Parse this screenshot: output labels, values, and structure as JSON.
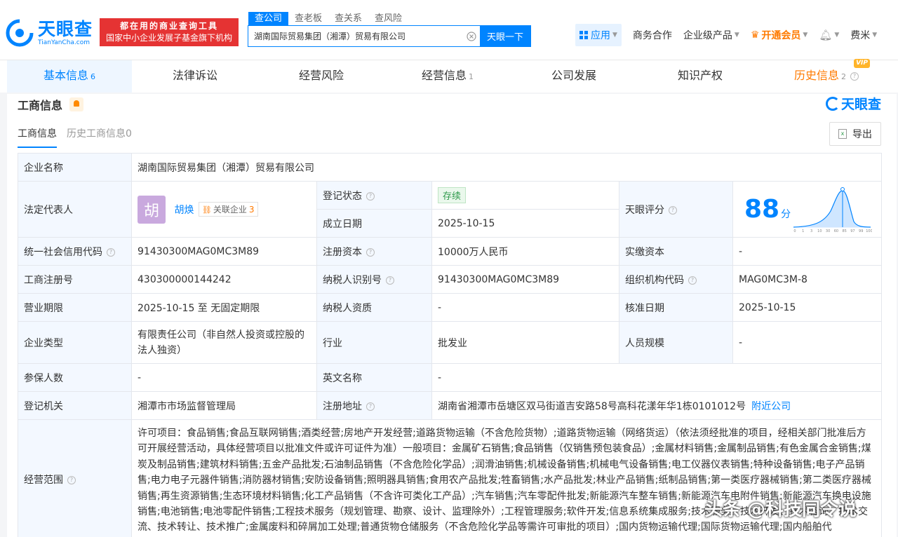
{
  "brand": {
    "name_cn": "天眼查",
    "name_en": "TianYanCha.com",
    "promo_line1": "都在用的商业查询工具",
    "promo_line2": "国家中小企业发展子基金旗下机构"
  },
  "search": {
    "tabs": [
      "查公司",
      "查老板",
      "查关系",
      "查风险"
    ],
    "value": "湖南国际贸易集团（湘潭）贸易有限公司",
    "button": "天眼一下"
  },
  "nav": {
    "app": "应用",
    "business": "商务合作",
    "enterprise": "企业级产品",
    "vip": "开通会员",
    "user": "费米"
  },
  "tabs": [
    {
      "label": "基本信息",
      "count": "6"
    },
    {
      "label": "法律诉讼",
      "count": ""
    },
    {
      "label": "经营风险",
      "count": ""
    },
    {
      "label": "经营信息",
      "count": "1"
    },
    {
      "label": "公司发展",
      "count": ""
    },
    {
      "label": "知识产权",
      "count": ""
    },
    {
      "label": "历史信息",
      "count": "2",
      "badge": "VIP"
    }
  ],
  "section": {
    "title": "工商信息",
    "brand_right": "天眼查",
    "subtab_active": "工商信息",
    "subtab_history": "历史工商信息0",
    "export": "导出"
  },
  "info": {
    "company_name_label": "企业名称",
    "company_name": "湖南国际贸易集团（湘潭）贸易有限公司",
    "legal_rep_label": "法定代表人",
    "legal_rep_avatar": "胡",
    "legal_rep_name": "胡焕",
    "related_label": "关联企业",
    "related_count": "3",
    "reg_status_label": "登记状态",
    "reg_status": "存续",
    "found_date_label": "成立日期",
    "found_date": "2025-10-15",
    "score_label": "天眼评分",
    "score": "88",
    "score_unit": "分",
    "credit_code_label": "统一社会信用代码",
    "credit_code": "91430300MAG0MC3M89",
    "reg_capital_label": "注册资本",
    "reg_capital": "10000万人民币",
    "paid_capital_label": "实缴资本",
    "paid_capital": "-",
    "reg_no_label": "工商注册号",
    "reg_no": "430300000144242",
    "taxpayer_id_label": "纳税人识别号",
    "taxpayer_id": "91430300MAG0MC3M89",
    "org_code_label": "组织机构代码",
    "org_code": "MAG0MC3M-8",
    "term_label": "营业期限",
    "term": "2025-10-15 至 无固定期限",
    "taxpayer_qual_label": "纳税人资质",
    "taxpayer_qual": "-",
    "approve_date_label": "核准日期",
    "approve_date": "2025-10-15",
    "type_label": "企业类型",
    "type": "有限责任公司（非自然人投资或控股的法人独资）",
    "industry_label": "行业",
    "industry": "批发业",
    "staff_label": "人员规模",
    "staff": "-",
    "insured_label": "参保人数",
    "insured": "-",
    "en_name_label": "英文名称",
    "en_name": "-",
    "authority_label": "登记机关",
    "authority": "湘潭市市场监督管理局",
    "address_label": "注册地址",
    "address": "湖南省湘潭市岳塘区双马街道吉安路58号高科花漾年华1栋0101012号",
    "nearby_link": "附近公司",
    "scope_label": "经营范围",
    "scope": "许可项目：食品销售;食品互联网销售;酒类经营;房地产开发经营;道路货物运输（不含危险货物）;道路货物运输（网络货运）（依法须经批准的项目，经相关部门批准后方可开展经营活动，具体经营项目以批准文件或许可证件为准）一般项目：金属矿石销售;食品销售（仅销售预包装食品）;金属材料销售;金属制品销售;有色金属合金销售;煤炭及制品销售;建筑材料销售;五金产品批发;石油制品销售（不含危险化学品）;润滑油销售;机械设备销售;机械电气设备销售;电工仪器仪表销售;特种设备销售;电子产品销售;电力电子元器件销售;消防器材销售;安防设备销售;照明器具销售;食用农产品批发;牲畜销售;水产品批发;林业产品销售;纸制品销售;第一类医疗器械销售;第二类医疗器械销售;再生资源销售;生态环境材料销售;化工产品销售（不含许可类化工产品）;汽车销售;汽车零配件批发;新能源汽车整车销售;新能源汽车电附件销售;新能源汽车换电设施销售;电池销售;电池零配件销售;工程技术服务（规划管理、勘察、设计、监理除外）;工程管理服务;软件开发;信息系统集成服务;技术服务、技术开发、技术咨询、技术交流、技术转让、技术推广;金属废料和碎屑加工处理;普通货物仓储服务（不含危险化学品等需许可审批的项目）;国内货物运输代理;国际货物运输代理;国内船舶代"
  },
  "score_chart": {
    "x_ticks": [
      "0",
      "1",
      "3",
      "10",
      "30",
      "60",
      "85",
      "97",
      "99",
      "100"
    ]
  },
  "watermark": "头条 @科技同令说"
}
